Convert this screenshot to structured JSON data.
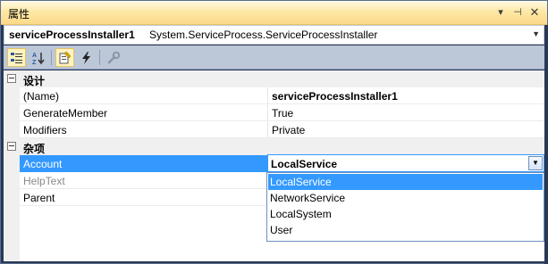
{
  "window": {
    "title": "属性"
  },
  "titlebar": {
    "dropdown_glyph": "▾",
    "pin_glyph": "⊣",
    "close_glyph": "✕"
  },
  "object_selector": {
    "name": "serviceProcessInstaller1",
    "type": "System.ServiceProcess.ServiceProcessInstaller"
  },
  "toolbar": {
    "buttons": [
      {
        "icon": "categorized-icon",
        "active": true
      },
      {
        "icon": "alphabetical-sort-icon",
        "active": false
      },
      {
        "icon": "properties-icon",
        "active": true
      },
      {
        "icon": "events-lightning-icon",
        "active": false
      },
      {
        "icon": "property-pages-wrench-icon",
        "active": false
      }
    ]
  },
  "grid": {
    "categories": [
      {
        "label": "设计",
        "rows": [
          {
            "name": "(Name)",
            "value": "serviceProcessInstaller1",
            "bold": true
          },
          {
            "name": "GenerateMember",
            "value": "True"
          },
          {
            "name": "Modifiers",
            "value": "Private"
          }
        ]
      },
      {
        "label": "杂项",
        "rows": [
          {
            "name": "Account",
            "value": "LocalService",
            "bold": true,
            "selected": true
          },
          {
            "name": "HelpText",
            "value": "",
            "disabled": true
          },
          {
            "name": "Parent",
            "value": ""
          }
        ]
      }
    ]
  },
  "dropdown": {
    "options": [
      "LocalService",
      "NetworkService",
      "LocalSystem",
      "User"
    ],
    "selected_index": 0
  },
  "colors": {
    "selection": "#3399ff",
    "title_bar": "#fde9a5",
    "frame": "#293955"
  }
}
